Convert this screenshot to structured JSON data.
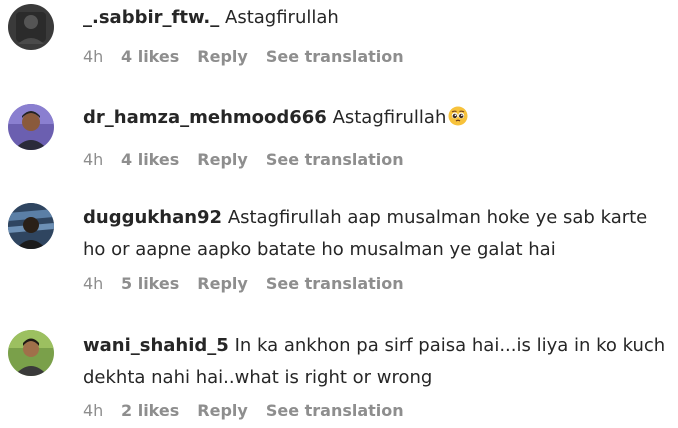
{
  "comments": [
    {
      "username": "_.sabbir_ftw._",
      "text": "Astagfirullah",
      "time": "4h",
      "likes": "4 likes",
      "reply": "Reply",
      "translation": "See translation"
    },
    {
      "username": "dr_hamza_mehmood666",
      "text": "Astagfirullah",
      "emoji": "pleading-face-emoji",
      "time": "4h",
      "likes": "4 likes",
      "reply": "Reply",
      "translation": "See translation"
    },
    {
      "username": "duggukhan92",
      "text": "Astagfirullah aap musalman hoke ye sab karte ho or aapne aapko batate ho musalman ye galat hai",
      "time": "4h",
      "likes": "5 likes",
      "reply": "Reply",
      "translation": "See translation"
    },
    {
      "username": "wani_shahid_5",
      "text": "In ka ankhon pa sirf paisa hai...is liya in ko kuch dekhta nahi hai..what is right or wrong",
      "time": "4h",
      "likes": "2 likes",
      "reply": "Reply",
      "translation": "See translation"
    }
  ]
}
